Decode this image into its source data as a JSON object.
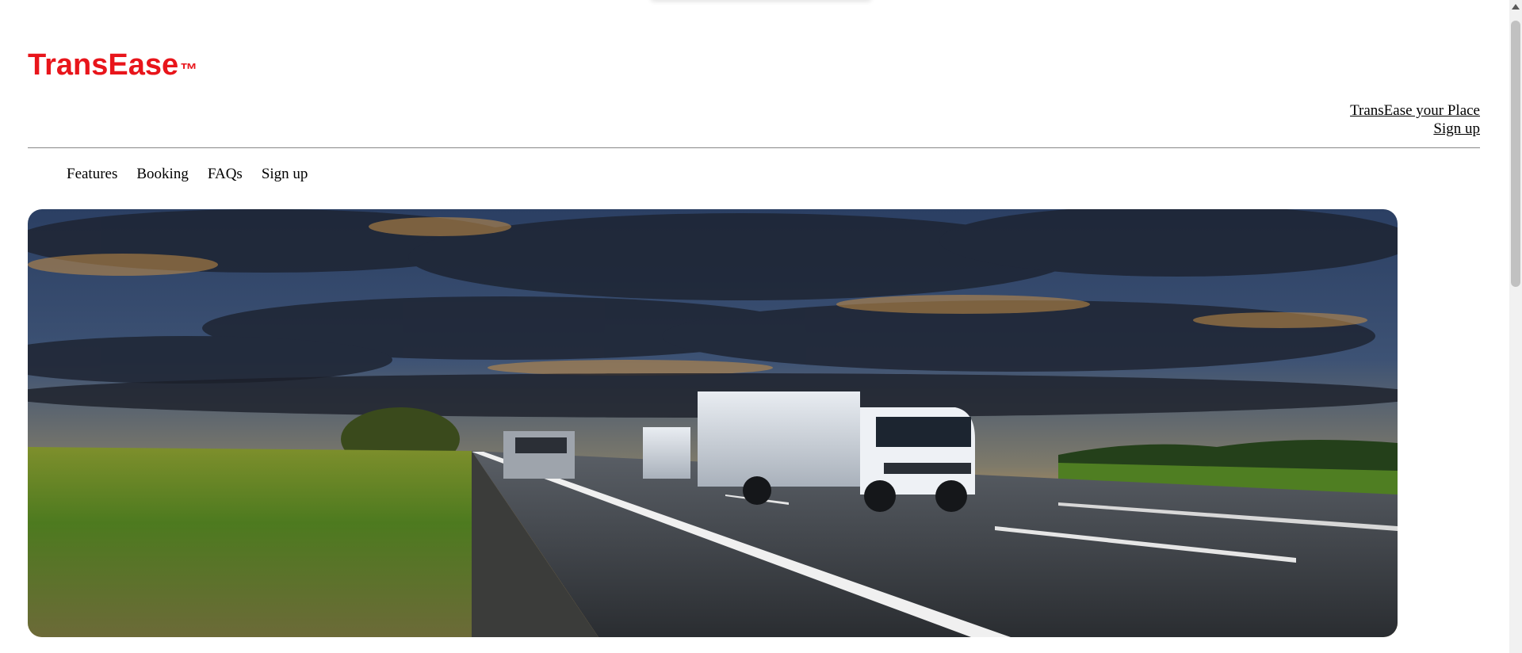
{
  "brand": {
    "name": "TransEase",
    "trademark": "™",
    "color": "#e8151b"
  },
  "header_links": [
    {
      "label": "TransEase your Place"
    },
    {
      "label": "Sign up"
    }
  ],
  "nav": {
    "items": [
      {
        "label": "Features"
      },
      {
        "label": "Booking"
      },
      {
        "label": "FAQs"
      },
      {
        "label": "Sign up"
      }
    ]
  },
  "hero": {
    "image": "trucks-on-highway-at-sunset"
  }
}
